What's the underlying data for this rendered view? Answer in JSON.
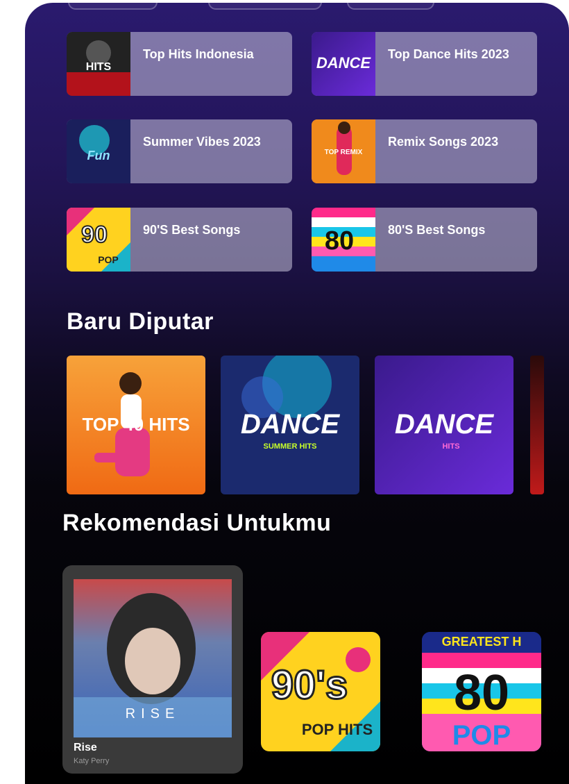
{
  "quick_tiles": [
    {
      "label": "Top Hits Indonesia",
      "icon": "top-hits-indonesia-cover"
    },
    {
      "label": "Top Dance Hits 2023",
      "icon": "dance-cover"
    },
    {
      "label": "Summer Vibes 2023",
      "icon": "summer-cover"
    },
    {
      "label": "Remix Songs 2023",
      "icon": "remix-cover"
    },
    {
      "label": "90'S Best Songs",
      "icon": "90s-cover"
    },
    {
      "label": "80'S Best Songs",
      "icon": "80s-cover"
    }
  ],
  "recent": {
    "title": "Baru Diputar",
    "albums": [
      {
        "art_text": "TOP 40 HITS",
        "icon": "top40-cover"
      },
      {
        "art_text": "DANCE",
        "art_sub": "SUMMER HITS",
        "icon": "dance-summer-cover"
      },
      {
        "art_text": "DANCE",
        "art_sub": "HITS",
        "icon": "dance-hits-cover"
      }
    ]
  },
  "recommend": {
    "title": "Rekomendasi Untukmu",
    "card": {
      "title": "Rise",
      "artist": "Katy Perry",
      "art_text": "RISE"
    },
    "albums": [
      {
        "art_text": "90's",
        "art_sub": "POP HITS",
        "icon": "90s-pop-hits-cover"
      },
      {
        "art_text": "80",
        "art_top": "GREATEST H",
        "art_sub": "POP",
        "icon": "80s-pop-cover"
      }
    ]
  },
  "colors": {
    "accent": "#2a1a6e",
    "tile_bg": "#bdb8d4"
  }
}
